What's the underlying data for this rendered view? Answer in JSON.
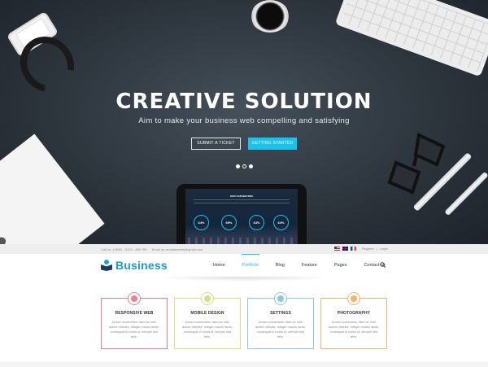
{
  "hero": {
    "title": "CREATIVE SOLUTION",
    "subtitle": "Aim to make your business web compelling and satisfying",
    "primary_button": "SUBMIT A TICKET",
    "secondary_button": "GETTING STARTED",
    "slider_dots": 3,
    "active_dot": 1
  },
  "tablet": {
    "heading": "OUR CAPABILITIES",
    "stats": [
      "64%",
      "69%",
      "64%",
      "64%"
    ]
  },
  "topbar": {
    "phone": "Call us: (+880) - 0123 - 456 789",
    "email": "Email us: envatomedia@gmail.com",
    "register": "Register",
    "separator": "|",
    "login": "Login"
  },
  "nav": {
    "logo_text": "Business",
    "items": [
      {
        "label": "Home",
        "active": false
      },
      {
        "label": "Portfolio",
        "active": true
      },
      {
        "label": "Blog",
        "active": false
      },
      {
        "label": "Feature",
        "active": false
      },
      {
        "label": "Pages",
        "active": false
      },
      {
        "label": "Contact us",
        "active": false
      }
    ]
  },
  "features": [
    {
      "title": "RESPONSIVE WEB",
      "color": "#f07f8e",
      "icon": "responsive-icon",
      "text": "Donec consectetur diam ac nibh auctor ultricies. Integer mauris lacus, consequat in luctus id, semper sed felis."
    },
    {
      "title": "MOBILE DESIGN",
      "color": "#d7e07a",
      "icon": "mobile-icon",
      "text": "Donec consectetur diam ac nibh auctor ultricies. Integer mauris lacus, consequat in luctus id, semper sed felis."
    },
    {
      "title": "SETTINGS",
      "color": "#8cc8ec",
      "icon": "gear-icon",
      "text": "Donec consectetur diam ac nibh auctor ultricies. Integer mauris lacus, consequat in luctus id, semper sed felis."
    },
    {
      "title": "PHOTOGRAPHY",
      "color": "#f5b56a",
      "icon": "camera-icon",
      "text": "Donec consectetur diam ac nibh auctor ultricies. Integer mauris lacus, consequat in luctus id, semper sed felis."
    }
  ],
  "colors": {
    "accent": "#19c3ef",
    "brand": "#1c9bd1"
  }
}
